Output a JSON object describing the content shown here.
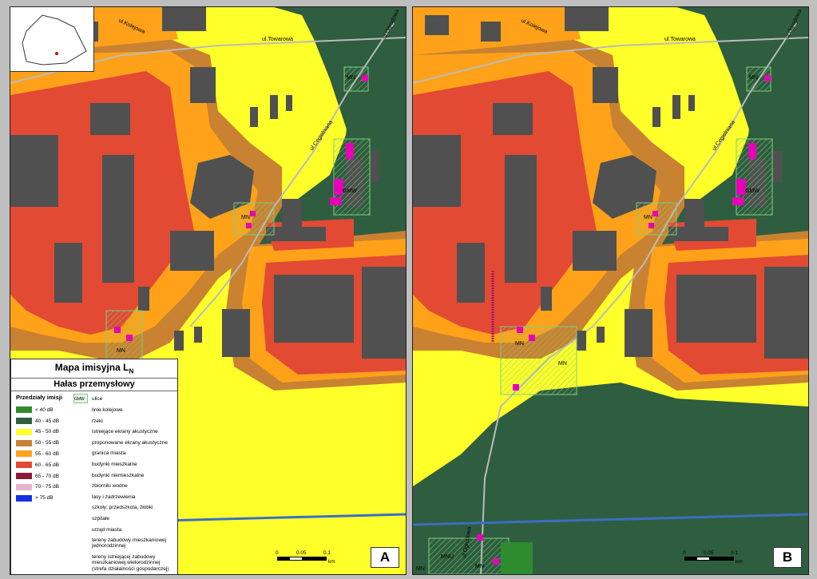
{
  "legend": {
    "title": "Mapa imisyjna L",
    "title_sub": "N",
    "subtitle": "Hałas przemysłowy",
    "ranges_heading": "Przedziały imisji",
    "ranges": [
      {
        "label": "< 40 dB",
        "color": "#2e8b2e"
      },
      {
        "label": "40 - 45 dB",
        "color": "#2f5d3f"
      },
      {
        "label": "45 - 50 dB",
        "color": "#ffff2a"
      },
      {
        "label": "50 - 55 dB",
        "color": "#c98231"
      },
      {
        "label": "55 - 60 dB",
        "color": "#ffa21a"
      },
      {
        "label": "60 - 65 dB",
        "color": "#e24a33"
      },
      {
        "label": "65 - 70 dB",
        "color": "#8b1a3a"
      },
      {
        "label": "70 - 75 dB",
        "color": "#e6b3cc"
      },
      {
        "label": "> 75 dB",
        "color": "#1432e0"
      }
    ],
    "symbols": [
      {
        "label": "ulice",
        "icon": "street-line-icon"
      },
      {
        "label": "linie kolejowe",
        "icon": "railway-line-icon"
      },
      {
        "label": "rzeki",
        "icon": "river-line-icon"
      },
      {
        "label": "istniejące ekrany akustyczne",
        "icon": "existing-barrier-icon"
      },
      {
        "label": "proponowane ekrany akustyczne",
        "icon": "proposed-barrier-icon"
      },
      {
        "label": "granica miasta",
        "icon": "city-boundary-icon"
      },
      {
        "label": "budynki mieszkalne",
        "icon": "residential-building-icon"
      },
      {
        "label": "budynki niemieszkalne",
        "icon": "non-residential-building-icon"
      },
      {
        "label": "zbiorniki wodne",
        "icon": "water-body-icon"
      },
      {
        "label": "lasy i zadrzewienia",
        "icon": "forest-icon"
      },
      {
        "label": "szkoły; przedszkola, żłobki",
        "icon": "school-icon"
      },
      {
        "label": "szpitale",
        "icon": "hospital-icon"
      },
      {
        "label": "urząd miasta",
        "icon": "city-hall-icon"
      },
      {
        "label": "tereny zabudowy mieszkaniowej jednorodzinnej",
        "icon": "single-family-zone-icon"
      },
      {
        "label": "tereny istniejącej zabudowy mieszkaniowej wielorodzinnej (strefa działalności gospodarczej)",
        "icon": "multi-family-zone-icon"
      }
    ],
    "symbol_badges": {
      "single_family": "MN",
      "multi_family": "GMW"
    }
  },
  "maps": {
    "panel_a_label": "A",
    "panel_b_label": "B",
    "street_label_1": "ul.Towarowa",
    "street_label_2": "ul.Cegielniana",
    "street_label_3": "ul.Kolejowa",
    "street_label_4": "ul.Ogrodowa",
    "zone_labels": [
      "MN",
      "MN",
      "MN",
      "GMW",
      "MN",
      "MNU"
    ]
  },
  "scale": {
    "t0": "0",
    "t1": "0.05",
    "t2": "0.1",
    "unit": "km"
  },
  "colors": {
    "bg_dark_green": "#2f5d3f",
    "yellow": "#ffff2a",
    "orange": "#ffa21a",
    "brown": "#c98231",
    "red": "#e24a33",
    "building": "#505050",
    "residential": "#e600b8",
    "zone_hatch": "#7ccf7c"
  }
}
